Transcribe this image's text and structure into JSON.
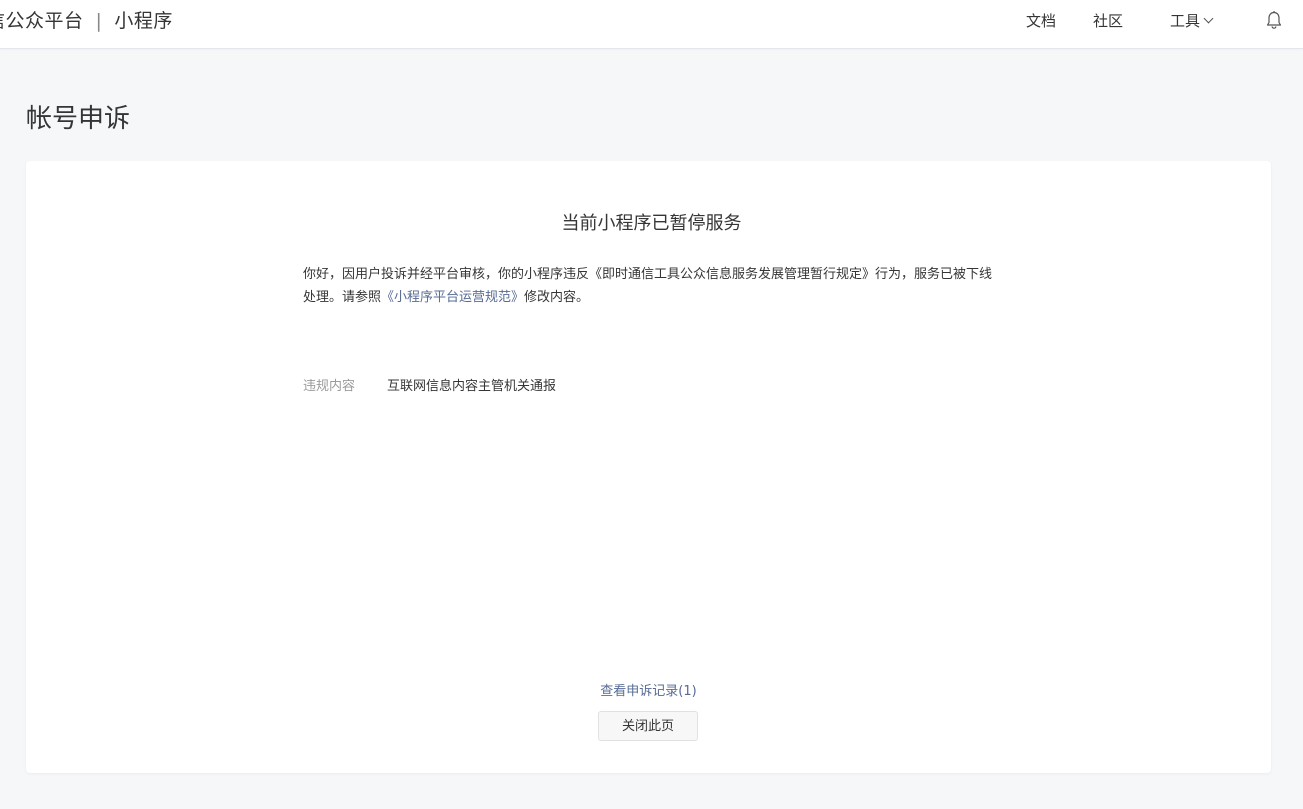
{
  "header": {
    "brand_left": "信公众平台",
    "brand_separator": "|",
    "brand_right": "小程序",
    "nav": {
      "docs": "文档",
      "community": "社区",
      "tools": "工具"
    }
  },
  "page": {
    "title": "帐号申诉"
  },
  "card": {
    "status_title": "当前小程序已暂停服务",
    "notice": {
      "line_prefix": "你好，因用户投诉并经平台审核，你的小程序违反《即时通信工具公众信息服务发展管理暂行规定》行为，服务已被下线处理。请参照",
      "link_text": "《小程序平台运营规范》",
      "line_suffix": "修改内容。"
    },
    "violation": {
      "label": "违规内容",
      "value": "互联网信息内容主管机关通报"
    },
    "records_link": "查看申诉记录(1)",
    "close_button": "关闭此页"
  },
  "icons": {
    "tools_dropdown": "chevron-down-icon",
    "notifications": "bell-icon"
  },
  "colors": {
    "link": "#576b95",
    "background": "#f6f7f9",
    "text": "#353535",
    "muted": "#9a9a9a"
  }
}
